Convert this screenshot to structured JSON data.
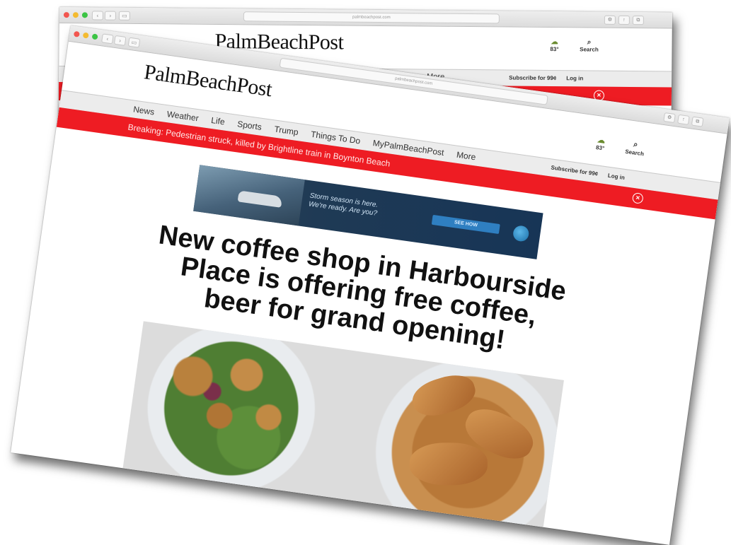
{
  "back_window": {
    "url": "palmbeachpost.com",
    "logo": "PalmBeachPost",
    "nav_more": "More",
    "weather_temp": "83°",
    "search_label": "Search",
    "subscribe": "Subscribe for 99¢",
    "login": "Log in"
  },
  "front_window": {
    "url": "palmbeachpost.com",
    "logo": "PalmBeachPost",
    "nav": [
      "News",
      "Weather",
      "Life",
      "Sports",
      "Trump",
      "Things To Do",
      "MyPalmBeachPost",
      "More"
    ],
    "weather_temp": "83°",
    "search_label": "Search",
    "subscribe": "Subscribe for 99¢",
    "login": "Log in",
    "breaking": "Breaking: Pedestrian struck, killed by Brightline train in Boynton Beach",
    "ad": {
      "line1": "Storm season is here.",
      "line2": "We're ready. Are you?",
      "button": "SEE HOW"
    },
    "headline": "New coffee shop in Harbourside Place is offering free coffee, beer for grand opening!"
  },
  "icons": {
    "weather": "cloud-sun-icon",
    "search": "search-icon",
    "close": "close-circle-icon",
    "share": "share-icon",
    "tabs": "tabs-icon",
    "sidebar": "sidebar-icon"
  },
  "colors": {
    "brand_red": "#ee1c23",
    "ad_navy": "#173556",
    "chrome_gray": "#dcdcdc"
  }
}
